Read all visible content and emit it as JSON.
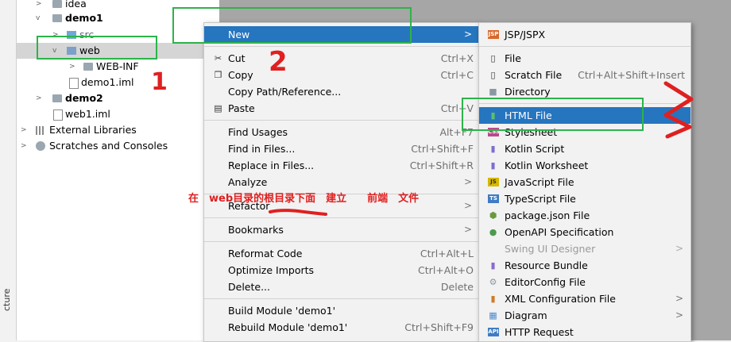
{
  "side_strip_label": "cture",
  "tree": [
    {
      "label": "idea",
      "bold": false,
      "icon": "folder-icon",
      "arrow": ">",
      "sel": false
    },
    {
      "label": "demo1",
      "bold": true,
      "icon": "module-folder-icon",
      "arrow": "v",
      "sel": false
    },
    {
      "label": "src",
      "bold": false,
      "icon": "source-folder-icon",
      "arrow": ">",
      "sel": false
    },
    {
      "label": "web",
      "bold": false,
      "icon": "web-folder-icon",
      "arrow": "v",
      "sel": true
    },
    {
      "label": "WEB-INF",
      "bold": false,
      "icon": "folder-icon",
      "arrow": ">",
      "sel": false
    },
    {
      "label": "demo1.iml",
      "bold": false,
      "icon": "iml-file-icon",
      "arrow": "",
      "sel": false
    },
    {
      "label": "demo2",
      "bold": true,
      "icon": "module-folder-icon",
      "arrow": ">",
      "sel": false
    },
    {
      "label": "web1.iml",
      "bold": false,
      "icon": "iml-file-icon",
      "arrow": "",
      "sel": false
    },
    {
      "label": "External Libraries",
      "bold": false,
      "icon": "library-icon",
      "arrow": ">",
      "sel": false
    },
    {
      "label": "Scratches and Consoles",
      "bold": false,
      "icon": "scratch-icon",
      "arrow": ">",
      "sel": false
    }
  ],
  "context_menu": {
    "new": {
      "label": "New",
      "submenu_arrow": ">"
    },
    "cut": {
      "label": "Cut",
      "shortcut": "Ctrl+X"
    },
    "copy": {
      "label": "Copy",
      "shortcut": "Ctrl+C"
    },
    "copy_path": {
      "label": "Copy Path/Reference..."
    },
    "paste": {
      "label": "Paste",
      "shortcut": "Ctrl+V"
    },
    "find_usages": {
      "label": "Find Usages",
      "shortcut": "Alt+F7"
    },
    "find_in_files": {
      "label": "Find in Files...",
      "shortcut": "Ctrl+Shift+F"
    },
    "replace_in_files": {
      "label": "Replace in Files...",
      "shortcut": "Ctrl+Shift+R"
    },
    "analyze": {
      "label": "Analyze",
      "submenu_arrow": ">"
    },
    "refactor": {
      "label": "Refactor",
      "submenu_arrow": ">"
    },
    "bookmarks": {
      "label": "Bookmarks",
      "submenu_arrow": ">"
    },
    "reformat": {
      "label": "Reformat Code",
      "shortcut": "Ctrl+Alt+L"
    },
    "optimize": {
      "label": "Optimize Imports",
      "shortcut": "Ctrl+Alt+O"
    },
    "delete": {
      "label": "Delete...",
      "shortcut": "Delete"
    },
    "build": {
      "label": "Build Module 'demo1'"
    },
    "rebuild": {
      "label": "Rebuild Module 'demo1'",
      "shortcut": "Ctrl+Shift+F9"
    }
  },
  "new_submenu": {
    "jsp": {
      "label": "JSP/JSPX",
      "tag": "JSP"
    },
    "file": {
      "label": "File"
    },
    "scratch": {
      "label": "Scratch File",
      "shortcut": "Ctrl+Alt+Shift+Insert"
    },
    "directory": {
      "label": "Directory"
    },
    "html": {
      "label": "HTML File"
    },
    "stylesheet": {
      "label": "Stylesheet",
      "tag": "CSS"
    },
    "kotlin_script": {
      "label": "Kotlin Script"
    },
    "kotlin_worksheet": {
      "label": "Kotlin Worksheet"
    },
    "javascript": {
      "label": "JavaScript File",
      "tag": "JS"
    },
    "typescript": {
      "label": "TypeScript File",
      "tag": "TS"
    },
    "package_json": {
      "label": "package.json File"
    },
    "openapi": {
      "label": "OpenAPI Specification"
    },
    "swing": {
      "label": "Swing UI Designer",
      "submenu_arrow": ">"
    },
    "resource_bundle": {
      "label": "Resource Bundle"
    },
    "editorconfig": {
      "label": "EditorConfig File"
    },
    "xml_config": {
      "label": "XML Configuration File",
      "submenu_arrow": ">"
    },
    "diagram": {
      "label": "Diagram",
      "submenu_arrow": ">"
    },
    "http_request": {
      "label": "HTTP Request",
      "tag": "API"
    }
  },
  "annotations": {
    "num1": "1",
    "num2": "2",
    "note": "在　web目录的根目录下面　建立　　前端　文件"
  },
  "colors": {
    "highlight": "#2675bf",
    "annotation_red": "#e02020",
    "annotation_green": "#2db34a"
  }
}
